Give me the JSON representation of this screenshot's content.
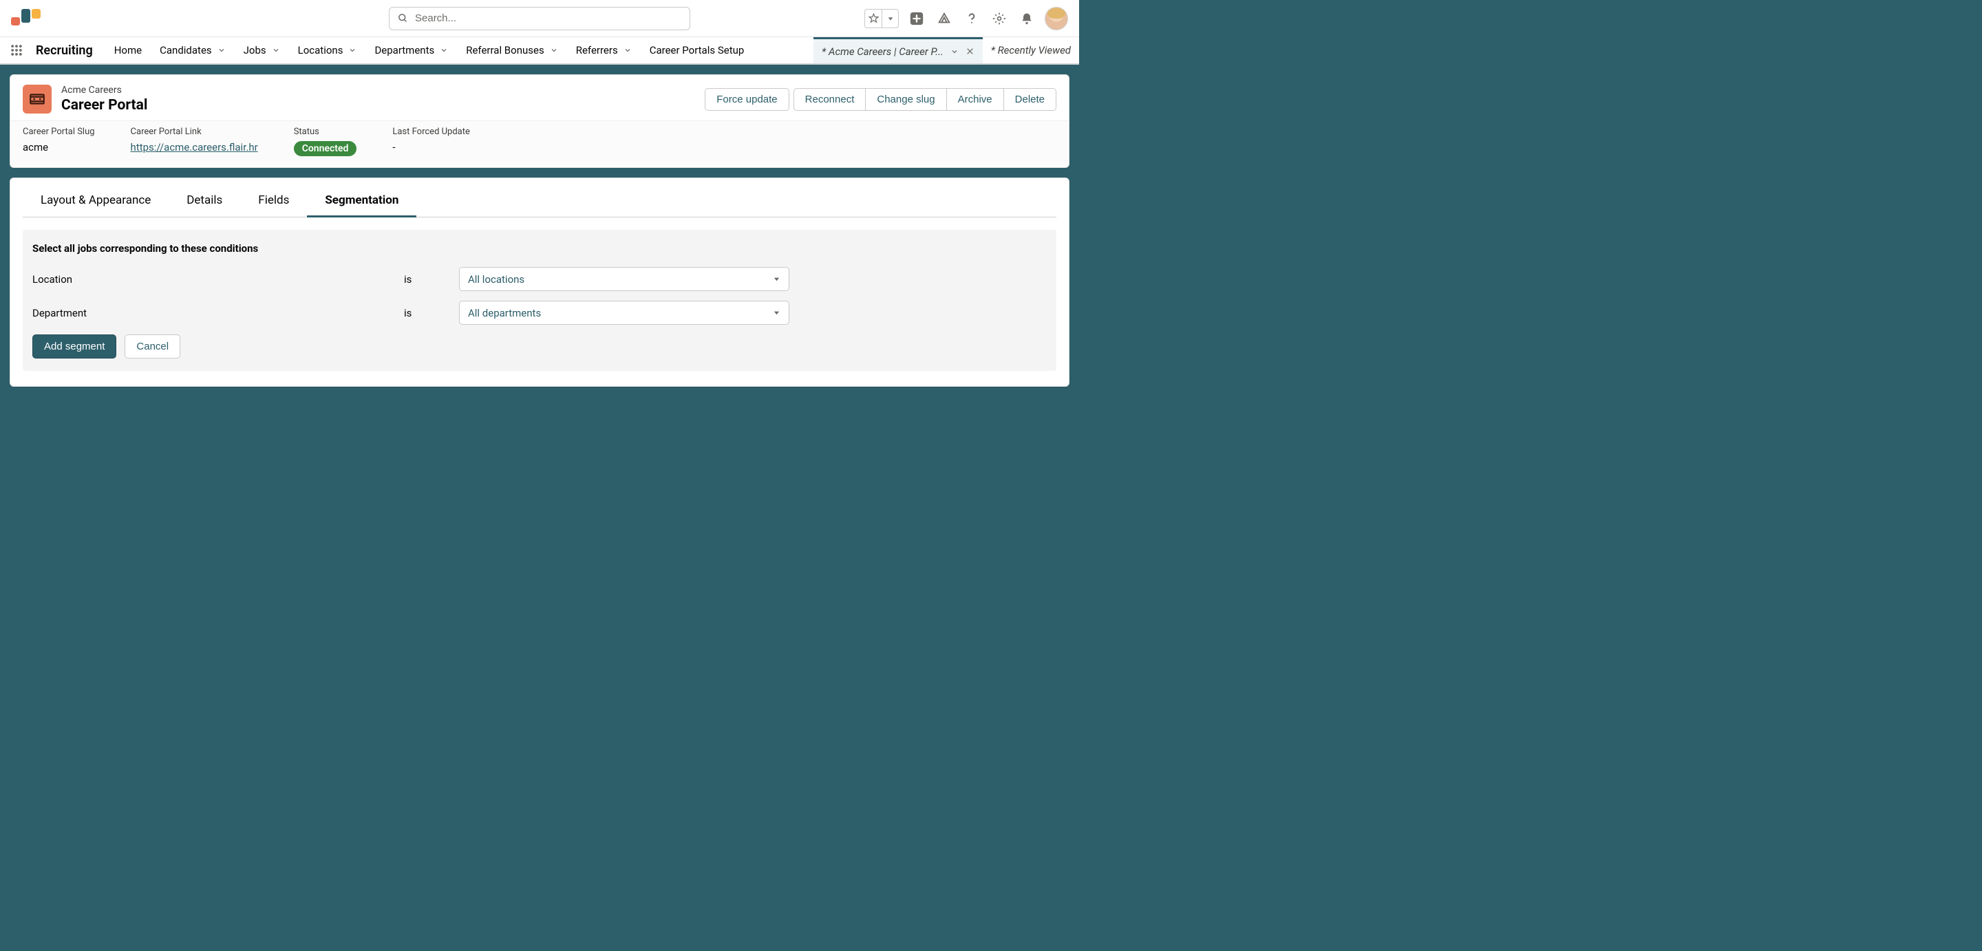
{
  "app_title": "Recruiting",
  "search": {
    "placeholder": "Search..."
  },
  "nav": {
    "items": [
      {
        "label": "Home",
        "dropdown": false
      },
      {
        "label": "Candidates",
        "dropdown": true
      },
      {
        "label": "Jobs",
        "dropdown": true
      },
      {
        "label": "Locations",
        "dropdown": true
      },
      {
        "label": "Departments",
        "dropdown": true
      },
      {
        "label": "Referral Bonuses",
        "dropdown": true
      },
      {
        "label": "Referrers",
        "dropdown": true
      },
      {
        "label": "Career Portals Setup",
        "dropdown": false
      }
    ]
  },
  "workspace_tabs": [
    {
      "label": "* Acme Careers | Career P...",
      "active": true,
      "closable": true,
      "dropdown": true
    },
    {
      "label": "* Recently Viewed",
      "active": false,
      "closable": false,
      "dropdown": false
    }
  ],
  "record_header": {
    "subtitle": "Acme Careers",
    "title": "Career Portal",
    "actions": [
      "Force update",
      "Reconnect",
      "Change slug",
      "Archive",
      "Delete"
    ]
  },
  "fields": {
    "slug": {
      "label": "Career Portal Slug",
      "value": "acme"
    },
    "link": {
      "label": "Career Portal Link",
      "value": "https://acme.careers.flair.hr"
    },
    "status": {
      "label": "Status",
      "value": "Connected"
    },
    "last_update": {
      "label": "Last Forced Update",
      "value": "-"
    }
  },
  "tabs": [
    "Layout & Appearance",
    "Details",
    "Fields",
    "Segmentation"
  ],
  "active_tab": "Segmentation",
  "segmentation": {
    "heading": "Select all jobs corresponding to these conditions",
    "conditions": [
      {
        "field": "Location",
        "operator": "is",
        "value": "All locations"
      },
      {
        "field": "Department",
        "operator": "is",
        "value": "All departments"
      }
    ],
    "add_label": "Add segment",
    "cancel_label": "Cancel"
  }
}
